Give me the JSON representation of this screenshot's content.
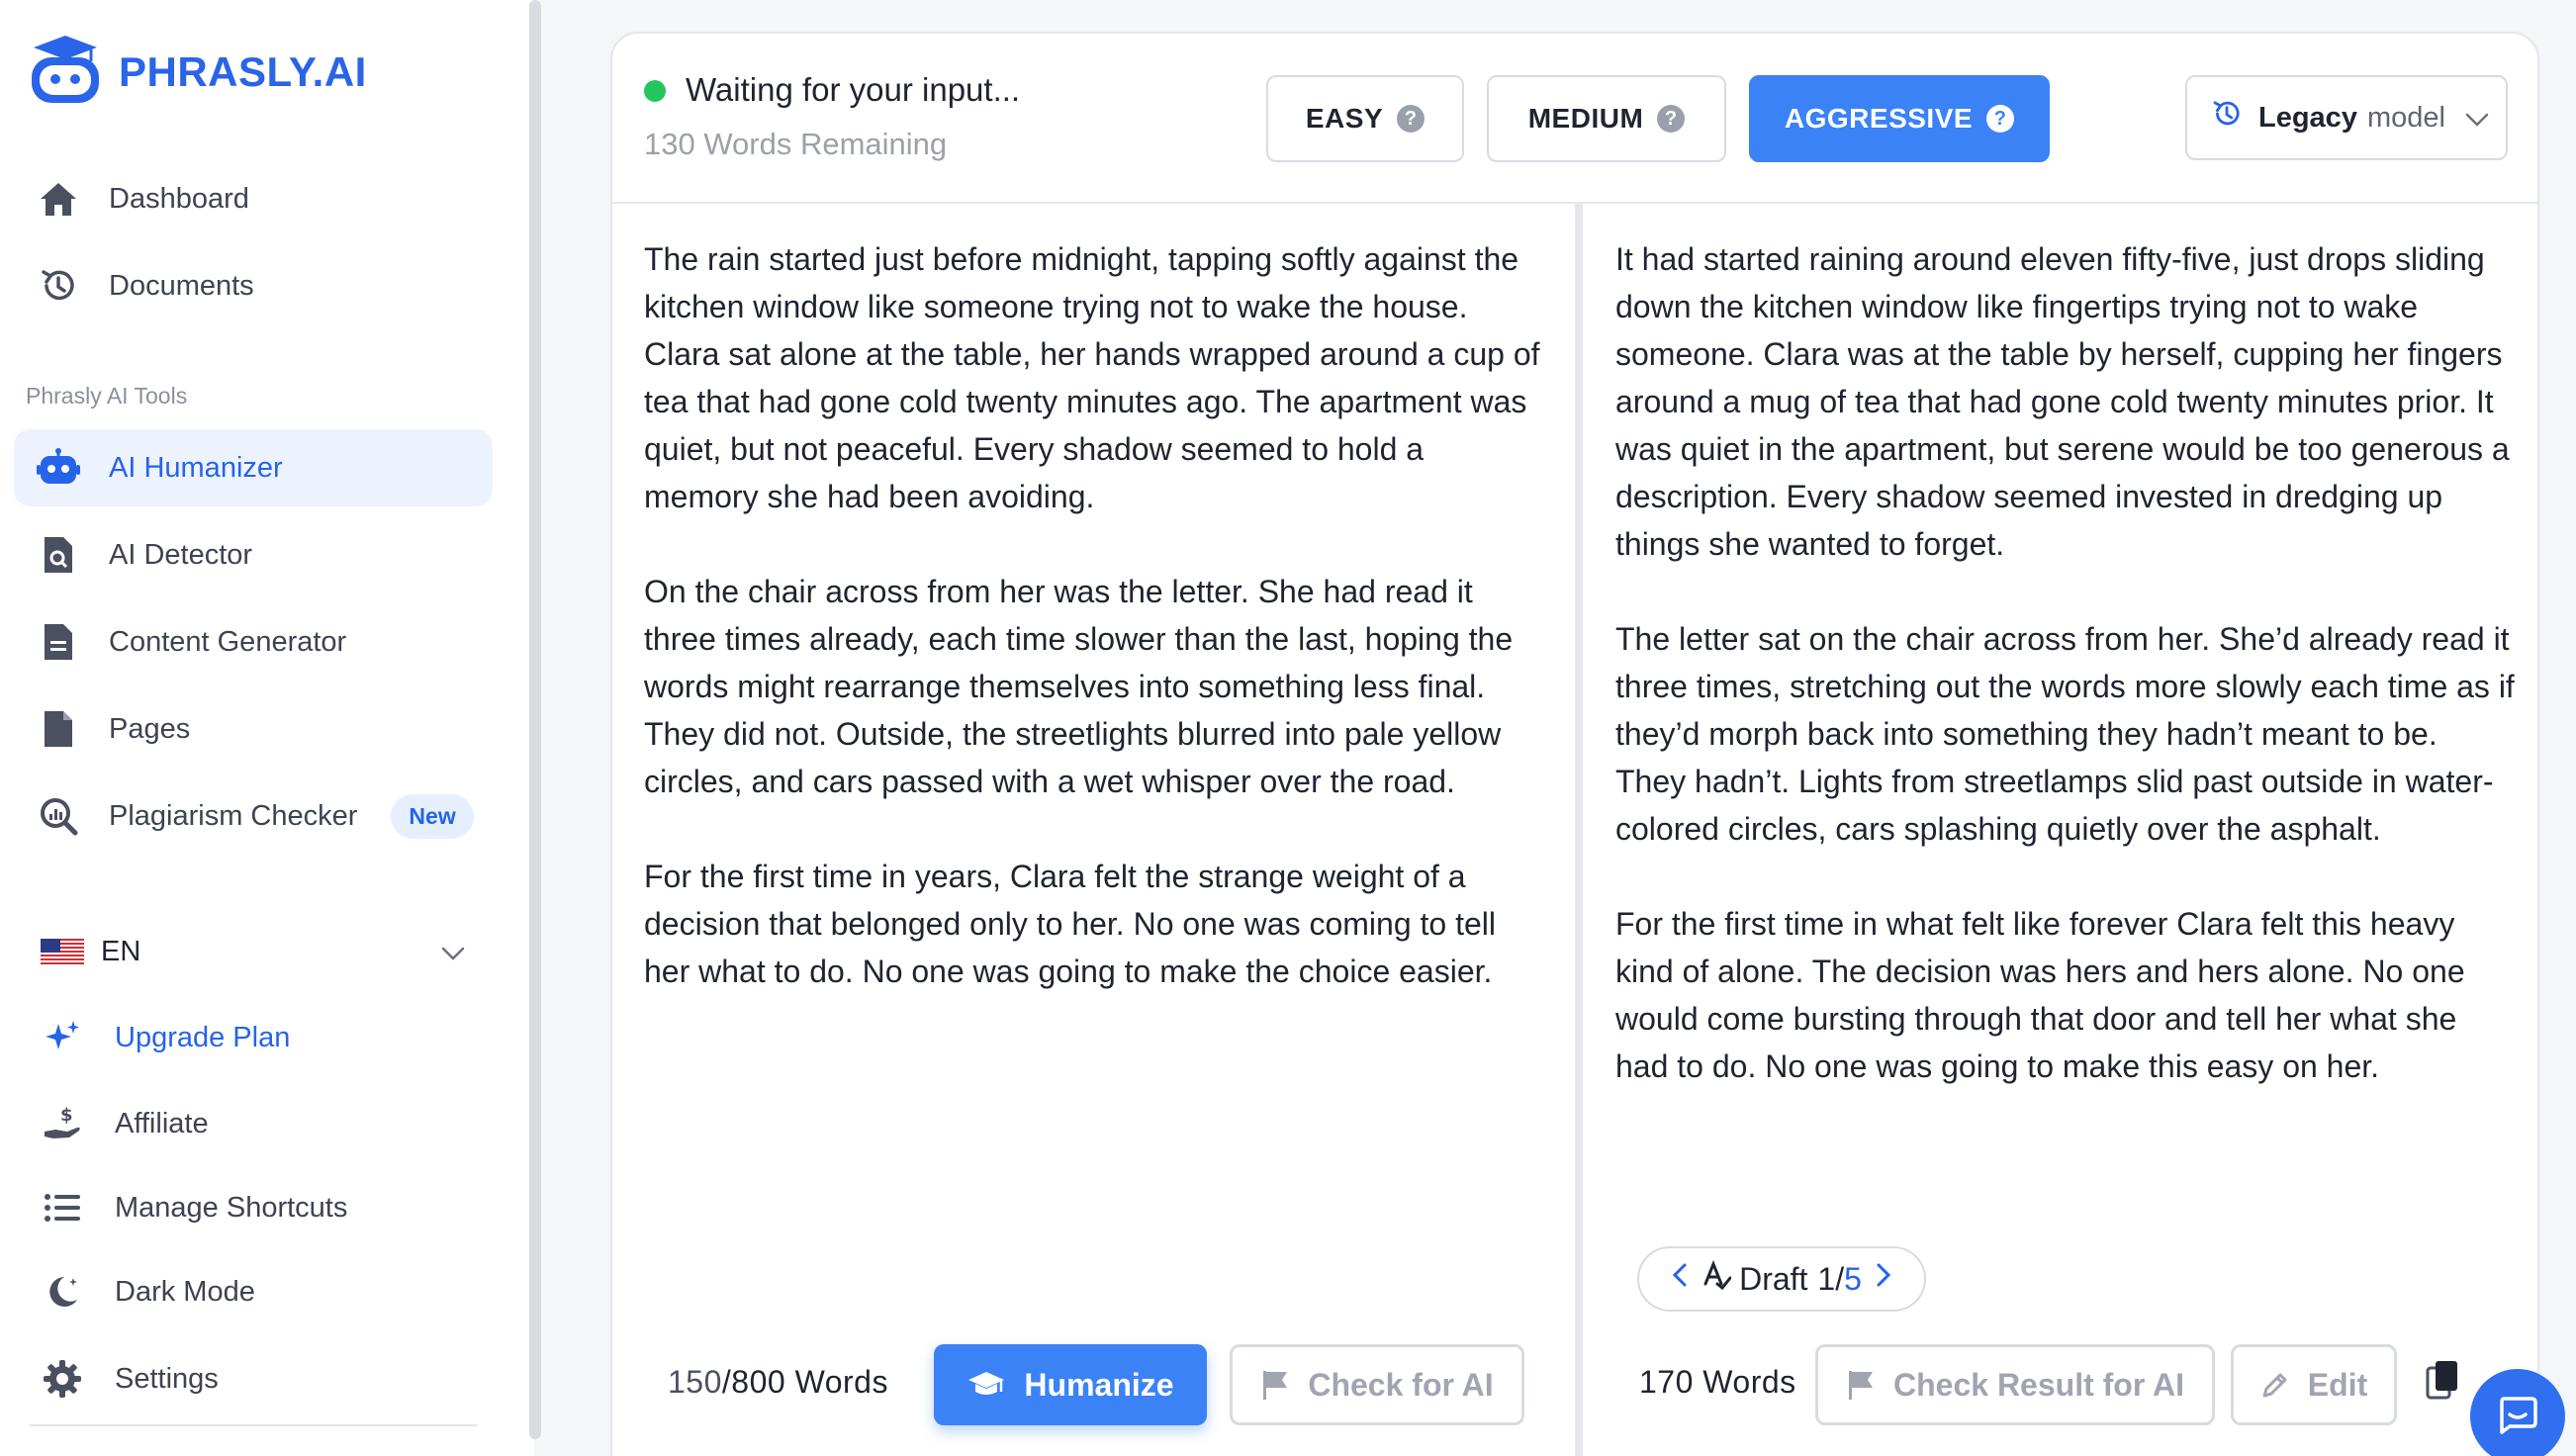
{
  "brand": {
    "name": "PHRASLY.AI",
    "color": "#2a64e8"
  },
  "sidebar": {
    "nav": [
      {
        "label": "Dashboard",
        "icon": "home-icon"
      },
      {
        "label": "Documents",
        "icon": "history-icon"
      }
    ],
    "tools_label": "Phrasly AI Tools",
    "tools": [
      {
        "label": "AI Humanizer",
        "icon": "robot-icon",
        "active": true
      },
      {
        "label": "AI Detector",
        "icon": "detector-icon"
      },
      {
        "label": "Content Generator",
        "icon": "document-icon"
      },
      {
        "label": "Pages",
        "icon": "page-icon"
      },
      {
        "label": "Plagiarism Checker",
        "icon": "magnify-icon",
        "badge": "New"
      }
    ],
    "language": {
      "code": "EN",
      "flag": "us-flag-icon"
    },
    "bottom": [
      {
        "label": "Upgrade Plan",
        "icon": "sparkle-icon"
      },
      {
        "label": "Affiliate",
        "icon": "dollar-hand-icon"
      },
      {
        "label": "Manage Shortcuts",
        "icon": "list-icon"
      },
      {
        "label": "Dark Mode",
        "icon": "moon-icon"
      },
      {
        "label": "Settings",
        "icon": "gear-icon"
      }
    ]
  },
  "editor": {
    "status": "Waiting for your input...",
    "status_color": "#22c55e",
    "words_remaining": "130 Words Remaining",
    "modes": [
      {
        "label": "EASY",
        "active": false
      },
      {
        "label": "MEDIUM",
        "active": false
      },
      {
        "label": "AGGRESSIVE",
        "active": true
      }
    ],
    "model": {
      "name": "Legacy",
      "suffix": "model"
    },
    "input_paragraphs": [
      "The rain started just before midnight, tapping softly against the kitchen window like someone trying not to wake the house. Clara sat alone at the table, her hands wrapped around a cup of tea that had gone cold twenty minutes ago. The apartment was quiet, but not peaceful. Every shadow seemed to hold a memory she had been avoiding.",
      "On the chair across from her was the letter. She had read it three times already, each time slower than the last, hoping the words might rearrange themselves into something less final. They did not. Outside, the streetlights blurred into pale yellow circles, and cars passed with a wet whisper over the road.",
      "For the first time in years, Clara felt the strange weight of a decision that belonged only to her. No one was coming to tell her what to do. No one was going to make the choice easier."
    ],
    "output_paragraphs": [
      "It had started raining around eleven fifty-five, just drops sliding down the kitchen window like fingertips trying not to wake someone. Clara was at the table by herself, cupping her fingers around a mug of tea that had gone cold twenty minutes prior. It was quiet in the apartment, but serene would be too generous a description. Every shadow seemed invested in dredging up things she wanted to forget.",
      "The letter sat on the chair across from her. She’d already read it three times, stretching out the words more slowly each time as if they’d morph back into something they hadn’t meant to be. They hadn’t. Lights from streetlamps slid past outside in water-colored circles, cars splashing quietly over the asphalt.",
      "For the first time in what felt like forever Clara felt this heavy kind of alone. The decision was hers and hers alone. No one would come bursting through that door and tell her what she had to do. No one was going to make this easy on her."
    ],
    "draft": {
      "label": "Draft",
      "current": "1",
      "sep": "/",
      "total": "5"
    },
    "input_count": {
      "used": "150",
      "max": "/800 Words"
    },
    "output_count": "170 Words",
    "buttons": {
      "humanize": "Humanize",
      "check_ai": "Check for AI",
      "check_result": "Check Result for AI",
      "edit": "Edit"
    }
  }
}
